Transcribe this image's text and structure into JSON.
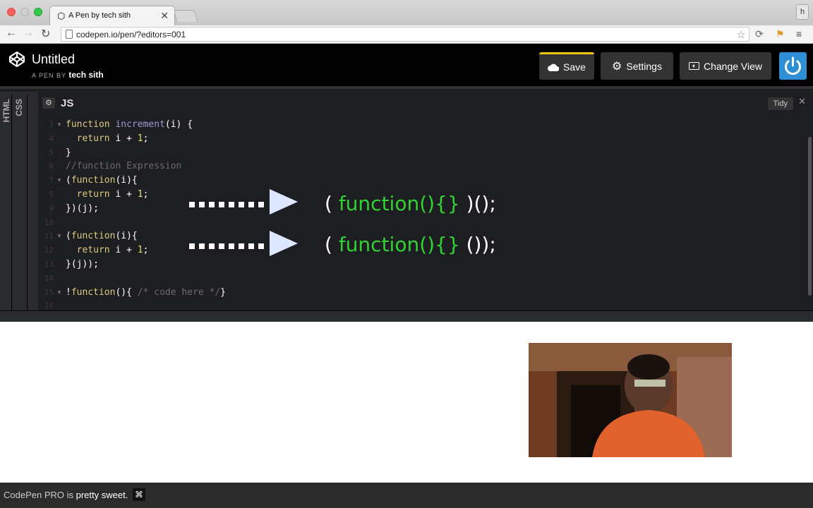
{
  "browser": {
    "tab_title": "A Pen by tech sith",
    "tab_close": "✕",
    "profile_initial": "h",
    "url": "codepen.io/pen/?editors=001"
  },
  "header": {
    "title": "Untitled",
    "byline_prefix": "A PEN BY",
    "author": "tech sith",
    "save_label": "Save",
    "settings_label": "Settings",
    "change_view_label": "Change View"
  },
  "editor": {
    "side_tabs": [
      "HTML",
      "CSS"
    ],
    "panel_label": "JS",
    "tidy_label": "Tidy",
    "lines": [
      {
        "num": "3",
        "fold": true,
        "tokens": [
          [
            "kw",
            "function "
          ],
          [
            "fn",
            "increment"
          ],
          [
            "pl",
            "(i) {"
          ]
        ]
      },
      {
        "num": "4",
        "fold": false,
        "tokens": [
          [
            "pl",
            "  "
          ],
          [
            "kw",
            "return"
          ],
          [
            "pl",
            " i + "
          ],
          [
            "num",
            "1"
          ],
          [
            "pl",
            ";"
          ]
        ]
      },
      {
        "num": "5",
        "fold": false,
        "tokens": [
          [
            "pl",
            "}"
          ]
        ]
      },
      {
        "num": "6",
        "fold": false,
        "tokens": [
          [
            "cm",
            "//function Expression"
          ]
        ]
      },
      {
        "num": "7",
        "fold": true,
        "tokens": [
          [
            "pl",
            "("
          ],
          [
            "kw",
            "function"
          ],
          [
            "pl",
            "(i){"
          ]
        ]
      },
      {
        "num": "8",
        "fold": false,
        "tokens": [
          [
            "pl",
            "  "
          ],
          [
            "kw",
            "return"
          ],
          [
            "pl",
            " i + "
          ],
          [
            "num",
            "1"
          ],
          [
            "pl",
            ";"
          ]
        ]
      },
      {
        "num": "9",
        "fold": false,
        "tokens": [
          [
            "pl",
            "})(j);"
          ]
        ]
      },
      {
        "num": "10",
        "fold": false,
        "tokens": []
      },
      {
        "num": "11",
        "fold": true,
        "tokens": [
          [
            "pl",
            "("
          ],
          [
            "kw",
            "function"
          ],
          [
            "pl",
            "(i){"
          ]
        ]
      },
      {
        "num": "12",
        "fold": false,
        "tokens": [
          [
            "pl",
            "  "
          ],
          [
            "kw",
            "return"
          ],
          [
            "pl",
            " i + "
          ],
          [
            "num",
            "1"
          ],
          [
            "pl",
            ";"
          ]
        ]
      },
      {
        "num": "13",
        "fold": false,
        "tokens": [
          [
            "pl",
            "}(j));"
          ]
        ]
      },
      {
        "num": "14",
        "fold": false,
        "tokens": []
      },
      {
        "num": "15",
        "fold": true,
        "tokens": [
          [
            "pl",
            "!"
          ],
          [
            "kw",
            "function"
          ],
          [
            "pl",
            "(){ "
          ],
          [
            "cm",
            "/* code here */"
          ],
          [
            "pl",
            "}"
          ]
        ]
      },
      {
        "num": "16",
        "fold": false,
        "tokens": []
      }
    ],
    "overlay": [
      {
        "pre": "( ",
        "fn": "function(){}",
        "post": " )();"
      },
      {
        "pre": "( ",
        "fn": "function(){}",
        "post": " ());"
      }
    ]
  },
  "footer": {
    "brand": "CodePen PRO",
    "mid": " is ",
    "tail": "pretty sweet.",
    "cmd": "⌘"
  },
  "colors": {
    "accent_save": "#f1c40f",
    "power_blue": "#2e8fd6",
    "overlay_green": "#32d232"
  }
}
